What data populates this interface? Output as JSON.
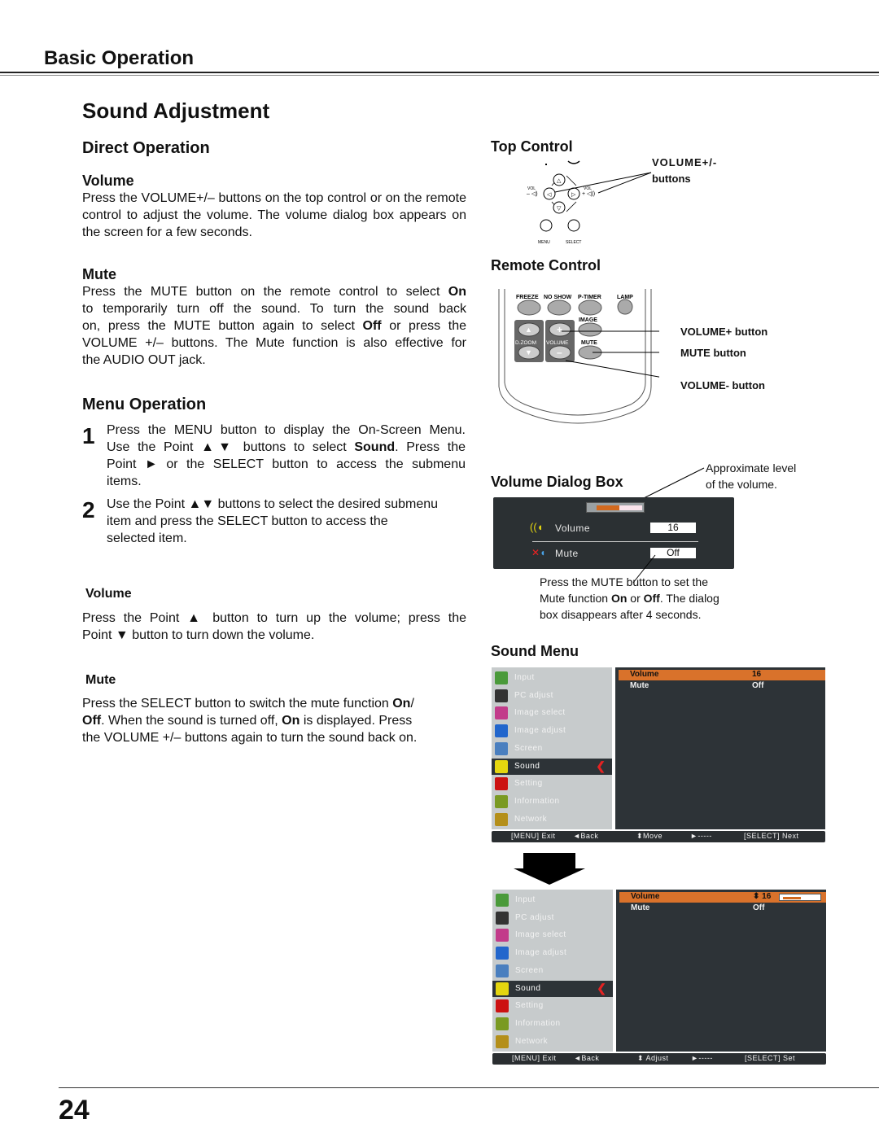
{
  "header": {
    "chapter": "Basic Operation",
    "section": "Sound Adjustment"
  },
  "direct_operation": {
    "title": "Direct Operation",
    "volume": {
      "title": "Volume",
      "text": "Press the VOLUME+/– buttons on the top control or on the remote control to adjust the volume. The volume dialog box appears on the screen for a few seconds."
    },
    "mute": {
      "title": "Mute",
      "lines": [
        "Press the MUTE button on the remote control to select On",
        "to temporarily turn off the sound. To turn the sound back",
        "on, press the MUTE button again to select Off or press the",
        "VOLUME +/– buttons. The Mute function is also effective for",
        "the AUDIO OUT jack."
      ]
    }
  },
  "menu_operation": {
    "title": "Menu Operation",
    "steps": [
      {
        "num": "1",
        "lines": [
          "Press the MENU button to display the On-Screen Menu.",
          "Use the Point ▲▼ buttons to select Sound. Press the",
          "Point ► or the SELECT button to access the submenu",
          "items."
        ]
      },
      {
        "num": "2",
        "lines": [
          "Use the Point ▲▼ buttons to select the desired submenu",
          "item and press the SELECT button to access the",
          "selected item."
        ]
      }
    ],
    "volume": {
      "title": "Volume",
      "lines": [
        "Press the Point ▲ button to turn up the volume; press the",
        "Point ▼ button to turn down the volume."
      ]
    },
    "mute": {
      "title": "Mute",
      "lines": [
        "Press the SELECT button to switch the mute function On/",
        "Off. When the sound is turned off, On is displayed. Press",
        "the VOLUME +/– buttons again to turn the sound back on."
      ]
    }
  },
  "top_control": {
    "title": "Top Control",
    "callout_line1": "VOLUME+/-",
    "callout_line2": "buttons",
    "vol_minus": "VOL",
    "vol_plus": "VOL",
    "menu_label": "MENU",
    "select_label": "SELECT"
  },
  "remote_control": {
    "title": "Remote Control",
    "button_labels": [
      "FREEZE",
      "NO SHOW",
      "P-TIMER",
      "LAMP",
      "IMAGE",
      "D.ZOOM",
      "VOLUME",
      "MUTE"
    ],
    "callouts": [
      "VOLUME+ button",
      "MUTE button",
      "VOLUME- button"
    ]
  },
  "volume_dialog": {
    "title": "Volume Dialog Box",
    "note_top_1": "Approximate level",
    "note_top_2": "of the volume.",
    "volume_label": "Volume",
    "volume_value": "16",
    "volume_level_fraction": 0.5,
    "mute_label": "Mute",
    "mute_value": "Off",
    "note_bottom": [
      "Press the MUTE button to set the",
      "Mute function On or Off. The dialog",
      "box disappears after 4 seconds."
    ]
  },
  "sound_menu": {
    "title": "Sound Menu",
    "menu_items": [
      "Input",
      "PC adjust",
      "Image select",
      "Image adjust",
      "Screen",
      "Sound",
      "Setting",
      "Information",
      "Network"
    ],
    "selected_item": "Sound",
    "sub_items": [
      {
        "label": "Volume",
        "value": "16"
      },
      {
        "label": "Mute",
        "value": "Off"
      }
    ],
    "footer1": [
      "Exit",
      "◄Back",
      "⬍Move",
      "►-----",
      "Next"
    ],
    "footer2": [
      "Exit",
      "◄Back",
      "⬍ Adjust",
      "►-----",
      "Set"
    ],
    "menu_key": "MENU",
    "select_key": "SELECT"
  },
  "page_number": "24"
}
